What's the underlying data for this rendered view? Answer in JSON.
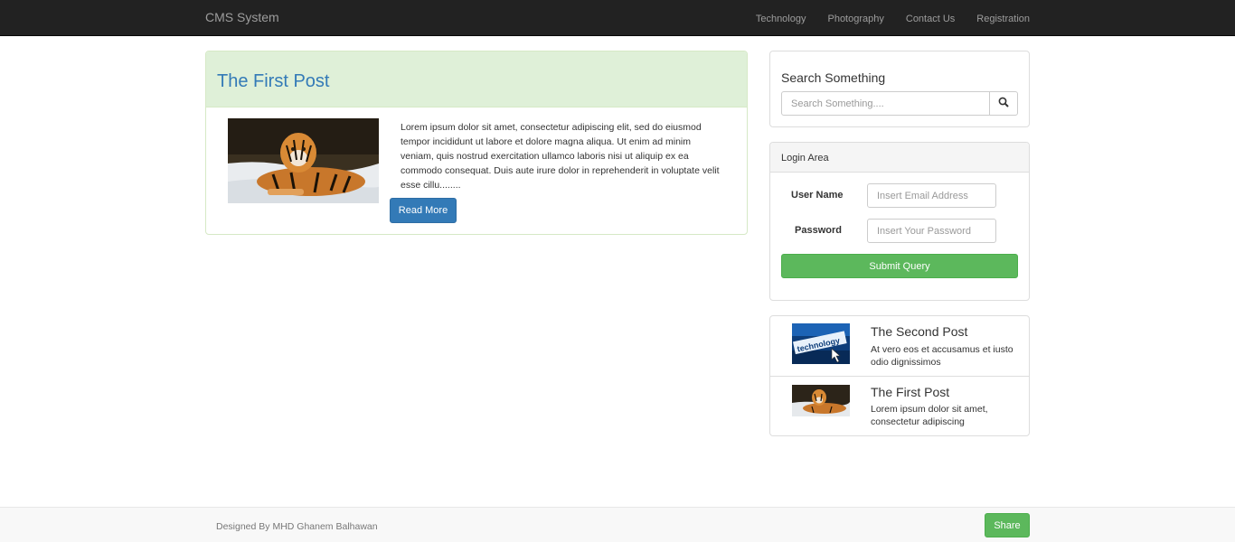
{
  "brand": "CMS System",
  "nav": {
    "items": [
      {
        "label": "Technology"
      },
      {
        "label": "Photography"
      },
      {
        "label": "Contact Us"
      },
      {
        "label": "Registration"
      }
    ]
  },
  "main_post": {
    "title": "The First Post",
    "image": "tiger-photo",
    "body": "Lorem ipsum dolor sit amet, consectetur adipiscing elit, sed do eiusmod tempor incididunt ut labore et dolore magna aliqua. Ut enim ad minim veniam, quis nostrud exercitation ullamco laboris nisi ut aliquip ex ea commodo consequat. Duis aute irure dolor in reprehenderit in voluptate velit esse cillu........",
    "read_more_label": "Read More"
  },
  "search": {
    "title": "Search Something",
    "placeholder": "Search Something....",
    "button_icon": "search-icon"
  },
  "login": {
    "title": "Login Area",
    "username_label": "User Name",
    "username_placeholder": "Insert Email Address",
    "password_label": "Password",
    "password_placeholder": "Insert Your Password",
    "submit_label": "Submit Query"
  },
  "recent_posts": [
    {
      "title": "The Second Post",
      "excerpt": "At vero eos et accusamus et iusto odio dignissimos",
      "image": "technology-thumbnail"
    },
    {
      "title": "The First Post",
      "excerpt": "Lorem ipsum dolor sit amet, consectetur adipiscing",
      "image": "tiger-thumbnail"
    }
  ],
  "footer": {
    "text": "Designed By MHD Ghanem Balhawan",
    "share_label": "Share"
  },
  "colors": {
    "navbar_bg": "#222222",
    "primary": "#337ab7",
    "success": "#5cb85c",
    "post_heading_bg": "#dff0d8"
  }
}
